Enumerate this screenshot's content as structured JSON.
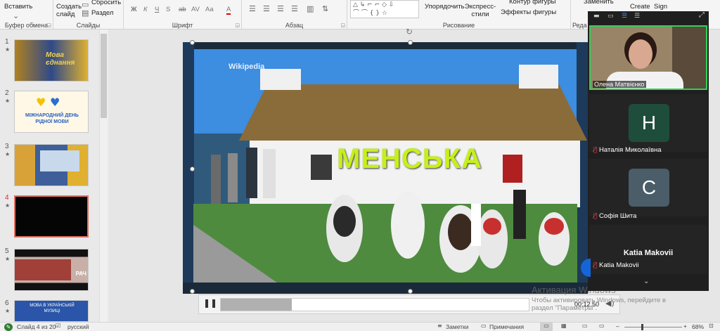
{
  "ribbon": {
    "groups": {
      "clipboard": "Буфер обмена",
      "slides": "Слайды",
      "font": "Шрифт",
      "paragraph": "Абзац",
      "drawing": "Рисование",
      "edit": "Реда"
    },
    "clipboard_paste": "Вставить",
    "slides_new": "Создать слайд",
    "slides_reset": "Сбросить",
    "slides_section": "Раздел",
    "font_buttons": [
      "Ж",
      "К",
      "Ч",
      "S",
      "ab",
      "AV",
      "Aa",
      "A"
    ],
    "arrange": "Упорядочить",
    "quick_styles": "Экспресс-стили",
    "shape_outline": "Контур фигуры",
    "shape_effects": "Эффекты фигуры",
    "replace": "Заменить",
    "create": "Create",
    "sign": "Sign"
  },
  "slides": [
    {
      "num": "1",
      "marker": "★",
      "caption": "Мова єднання"
    },
    {
      "num": "2",
      "marker": "★",
      "caption": "МІЖНАРОДНИЙ ДЕНЬ РІДНОЇ МОВИ"
    },
    {
      "num": "3",
      "marker": "★",
      "caption": ""
    },
    {
      "num": "4",
      "marker": "★",
      "caption": ""
    },
    {
      "num": "5",
      "marker": "★",
      "caption": "РАЧ"
    },
    {
      "num": "6",
      "marker": "★",
      "caption": "МОВА В УКРАЇНСЬКІЙ МУЗИЦІ"
    }
  ],
  "slide": {
    "watermark": "Wikipedia",
    "title": "МЕНСЬКА"
  },
  "video": {
    "time": "00:12,50"
  },
  "zoom": {
    "self_name": "Олена Матвієнко",
    "participants": [
      {
        "initial": "Н",
        "name": "Наталія Миколаївна",
        "color": "#1f4d3c"
      },
      {
        "initial": "С",
        "name": "Софія Шита",
        "color": "#4a5d68"
      }
    ],
    "host_name": "Katia Makovii",
    "host_tag": "Katia Makovii"
  },
  "watermark": {
    "title": "Активация Windows",
    "line1": "Чтобы активировать Windows, перейдите в",
    "line2": "раздел \"Параметры\"."
  },
  "status": {
    "slide_info": "Слайд 4 из 20",
    "language": "русский",
    "notes": "Заметки",
    "comments": "Примечания",
    "zoom_pct": "68%"
  },
  "colors": {
    "accent": "#c4314b",
    "title": "#c6f019"
  }
}
